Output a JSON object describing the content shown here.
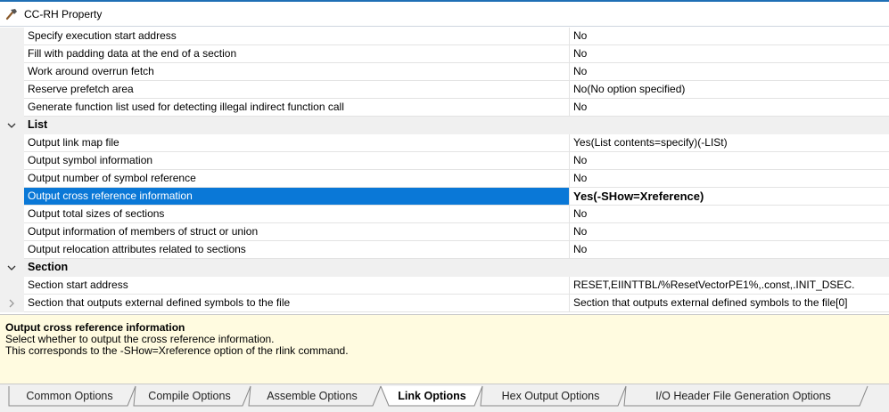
{
  "window": {
    "title": "CC-RH Property",
    "icon": "hammer-icon"
  },
  "grid": {
    "rows_top": [
      {
        "name": "Specify execution start address",
        "value": "No"
      },
      {
        "name": "Fill with padding data at the end of a section",
        "value": "No"
      },
      {
        "name": "Work around overrun fetch",
        "value": "No"
      },
      {
        "name": "Reserve prefetch area",
        "value": "No(No option specified)"
      },
      {
        "name": "Generate function list used for detecting illegal indirect function call",
        "value": "No"
      }
    ],
    "category_list": {
      "label": "List",
      "expanded": true
    },
    "rows_list": [
      {
        "name": "Output link map file",
        "value": "Yes(List contents=specify)(-LISt)"
      },
      {
        "name": "Output symbol information",
        "value": "No"
      },
      {
        "name": "Output number of symbol reference",
        "value": "No"
      },
      {
        "name": "Output cross reference information",
        "value": "Yes(-SHow=Xreference)",
        "selected": true
      },
      {
        "name": "Output total sizes of sections",
        "value": "No"
      },
      {
        "name": "Output information of members of struct or union",
        "value": "No"
      },
      {
        "name": "Output relocation attributes related to sections",
        "value": "No"
      }
    ],
    "category_section": {
      "label": "Section",
      "expanded": true
    },
    "rows_section": [
      {
        "name": "Section start address",
        "value": "RESET,EIINTTBL/%ResetVectorPE1%,.const,.INIT_DSEC."
      },
      {
        "name": "Section that outputs external defined symbols to the file",
        "value": "Section that outputs external defined symbols to the file[0]",
        "expandable": true
      }
    ]
  },
  "description": {
    "title": "Output cross reference information",
    "line1": "Select whether to output the cross reference information.",
    "line2": "This corresponds to the -SHow=Xreference option of the rlink command."
  },
  "tabs": [
    {
      "label": "Common Options"
    },
    {
      "label": "Compile Options"
    },
    {
      "label": "Assemble Options"
    },
    {
      "label": "Link Options",
      "active": true
    },
    {
      "label": "Hex Output Options"
    },
    {
      "label": "I/O Header File Generation Options"
    }
  ],
  "colors": {
    "selection": "#0a78d7",
    "accent": "#1f6fb5",
    "description_bg": "#fffbe0"
  }
}
